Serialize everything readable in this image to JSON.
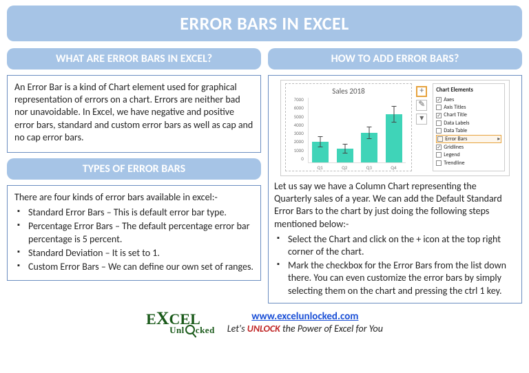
{
  "title": "ERROR BARS IN EXCEL",
  "left": {
    "header1": "WHAT ARE ERROR BARS IN EXCEL?",
    "intro": "An Error Bar is a kind of Chart element used for graphical representation of errors on a chart. Errors are neither bad nor unavoidable. In Excel, we have negative and positive error bars, standard and custom error bars as well as cap and no cap error bars.",
    "header2": "TYPES OF ERROR BARS",
    "types_intro": "There are four kinds of error bars available in excel:-",
    "types": {
      "0": "Standard Error Bars – This is default error bar type.",
      "1": "Percentage Error Bars – The default percentage error bar percentage is 5 percent.",
      "2": "Standard Deviation – It is set to 1.",
      "3": "Custom Error Bars – We can define our own set of ranges."
    }
  },
  "right": {
    "header": "HOW TO ADD ERROR BARS?",
    "chart_title": "Sales 2018",
    "desc": "Let us say we have a Column Chart representing the Quarterly sales of a year. We can add the Default Standard Error Bars to the chart by just doing the following steps mentioned below:-",
    "steps": {
      "0": "Select the Chart and click on the + icon at the top right corner of the chart.",
      "1": "Mark the checkbox for the Error Bars from the list down there. You can even customize the error bars by simply selecting them on the chart and pressing the ctrl 1 key."
    },
    "elements_header": "Chart Elements",
    "elements": {
      "0": "Axes",
      "1": "Axis Titles",
      "2": "Chart Title",
      "3": "Data Labels",
      "4": "Data Table",
      "5": "Error Bars",
      "6": "Gridlines",
      "7": "Legend",
      "8": "Trendline"
    }
  },
  "yticks": {
    "0": "7000",
    "1": "6000",
    "2": "5000",
    "3": "4000",
    "4": "3000",
    "5": "2000",
    "6": "1000",
    "7": "0"
  },
  "xticks": {
    "0": "Q1",
    "1": "Q2",
    "2": "Q3",
    "3": "Q4"
  },
  "footer": {
    "url": "www.excelunlocked.com",
    "tag_pre": "Let's ",
    "tag_unlock": "UNLOCK",
    "tag_post": " the Power of Excel for You"
  },
  "chart_data": {
    "type": "bar",
    "title": "Sales 2018",
    "categories": [
      "Q1",
      "Q2",
      "Q3",
      "Q4"
    ],
    "values": [
      2200,
      1500,
      3200,
      5200
    ],
    "error": [
      600,
      500,
      700,
      900
    ],
    "ylim": [
      0,
      7000
    ],
    "xlabel": "",
    "ylabel": ""
  }
}
